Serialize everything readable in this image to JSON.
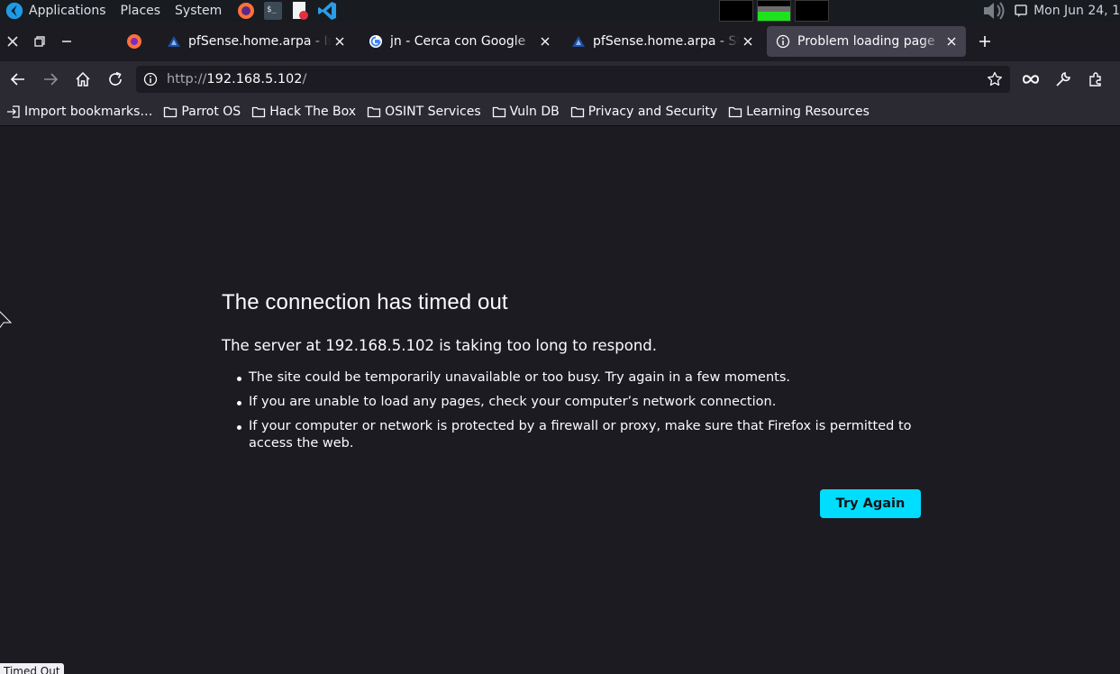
{
  "panel": {
    "applications_label": "Applications",
    "places_label": "Places",
    "system_label": "System",
    "clock": "Mon Jun 24, 1"
  },
  "tabs": [
    {
      "title": "pfSense.home.arpa - Interfaces",
      "favicon": "pfsense-icon"
    },
    {
      "title": "jn - Cerca con Google",
      "favicon": "google-icon"
    },
    {
      "title": "pfSense.home.arpa - Status",
      "favicon": "pfsense-icon"
    },
    {
      "title": "Problem loading page",
      "favicon": "info-icon",
      "active": true
    }
  ],
  "urlbar": {
    "scheme": "http://",
    "host": "192.168.5.102",
    "path": "/"
  },
  "bookmarks": [
    {
      "label": "Import bookmarks…",
      "icon": "import-icon"
    },
    {
      "label": "Parrot OS",
      "icon": "folder-icon"
    },
    {
      "label": "Hack The Box",
      "icon": "folder-icon"
    },
    {
      "label": "OSINT Services",
      "icon": "folder-icon"
    },
    {
      "label": "Vuln DB",
      "icon": "folder-icon"
    },
    {
      "label": "Privacy and Security",
      "icon": "folder-icon"
    },
    {
      "label": "Learning Resources",
      "icon": "folder-icon"
    }
  ],
  "error": {
    "title": "The connection has timed out",
    "description": "The server at 192.168.5.102 is taking too long to respond.",
    "hints": [
      "The site could be temporarily unavailable or too busy. Try again in a few moments.",
      "If you are unable to load any pages, check your computer’s network connection.",
      "If your computer or network is protected by a firewall or proxy, make sure that Firefox is permitted to access the web."
    ],
    "try_again_label": "Try Again"
  },
  "status_text": "Timed Out",
  "colors": {
    "accent": "#00ddff",
    "page_background": "#1c1b22",
    "toolbar_background": "#2b2a33",
    "active_tab": "#42414d"
  }
}
